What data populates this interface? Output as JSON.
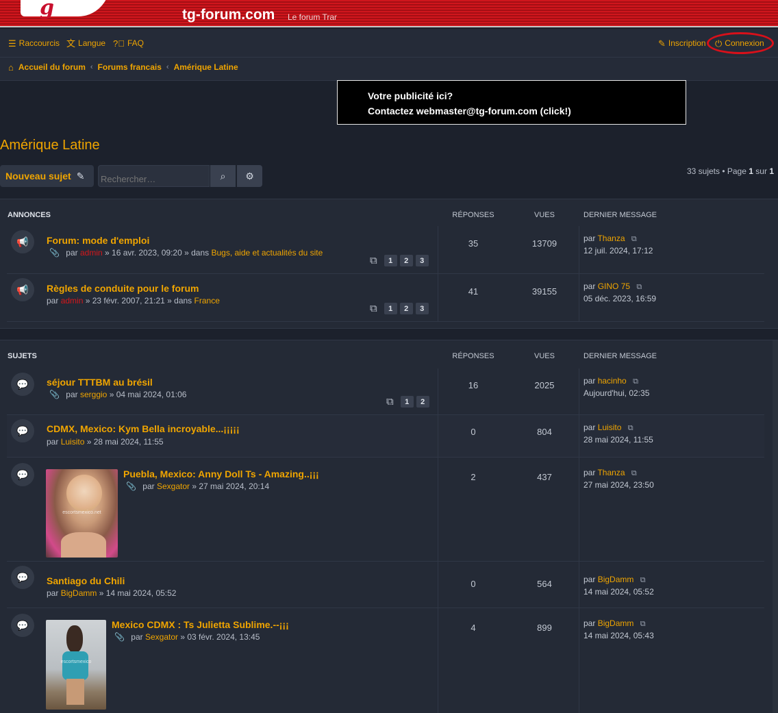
{
  "site": {
    "title": "tg-forum.com",
    "description": "Le forum Tran"
  },
  "nav": {
    "quick_links": "Raccourcis",
    "language": "Langue",
    "faq": "FAQ",
    "register": "Inscription",
    "login": "Connexion"
  },
  "breadcrumbs": [
    "Accueil du forum",
    "Forums francais",
    "Amérique Latine"
  ],
  "ad": {
    "line1": "Votre publicité ici?",
    "line2": "Contactez webmaster@tg-forum.com (click!)"
  },
  "forum": {
    "title": "Amérique Latine",
    "new_topic": "Nouveau sujet",
    "search_placeholder": "Rechercher…",
    "topic_count": "33 sujets • Page",
    "page_current": "1",
    "page_of": "sur",
    "page_total": "1"
  },
  "columns": {
    "replies": "RÉPONSES",
    "views": "VUES",
    "last_post": "DERNIER MESSAGE"
  },
  "announcements": {
    "label": "ANNONCES",
    "rows": [
      {
        "title": "Forum: mode d'emploi",
        "by": "par",
        "author": "admin",
        "date": "» 16 avr. 2023, 09:20 » dans",
        "forum": "Bugs, aide et actualités du site",
        "pages": [
          "1",
          "2",
          "3"
        ],
        "replies": "35",
        "views": "13709",
        "last_by": "par",
        "last_user": "Thanza",
        "last_date": "12 juil. 2024, 17:12"
      },
      {
        "title": "Règles de conduite pour le forum",
        "by": "par",
        "author": "admin",
        "date": "» 23 févr. 2007, 21:21 » dans",
        "forum": "France",
        "pages": [
          "1",
          "2",
          "3"
        ],
        "replies": "41",
        "views": "39155",
        "last_by": "par",
        "last_user": "GINO 75",
        "last_date": "05 déc. 2023, 16:59"
      }
    ]
  },
  "topics": {
    "label": "SUJETS",
    "rows": [
      {
        "title": "séjour TTTBM au brésil",
        "by": "par",
        "author": "serggio",
        "date": "» 04 mai 2024, 01:06",
        "pages": [
          "1",
          "2"
        ],
        "replies": "16",
        "views": "2025",
        "last_by": "par",
        "last_user": "hacinho",
        "last_date": "Aujourd'hui, 02:35"
      },
      {
        "title": "CDMX, Mexico: Kym Bella incroyable...¡¡¡¡¡",
        "by": "par",
        "author": "Luisito",
        "date": "» 28 mai 2024, 11:55",
        "replies": "0",
        "views": "804",
        "last_by": "par",
        "last_user": "Luisito",
        "last_date": "28 mai 2024, 11:55"
      },
      {
        "title": "Puebla, Mexico: Anny Doll Ts - Amazing..¡¡¡",
        "by": "par",
        "author": "Sexgator",
        "date": "» 27 mai 2024, 20:14",
        "thumb_text": "escortsmexico.net",
        "replies": "2",
        "views": "437",
        "last_by": "par",
        "last_user": "Thanza",
        "last_date": "27 mai 2024, 23:50"
      },
      {
        "title": "Santiago du Chili",
        "by": "par",
        "author": "BigDamm",
        "date": "» 14 mai 2024, 05:52",
        "replies": "0",
        "views": "564",
        "last_by": "par",
        "last_user": "BigDamm",
        "last_date": "14 mai 2024, 05:52"
      },
      {
        "title": "Mexico CDMX : Ts Julietta Sublime.--¡¡¡",
        "by": "par",
        "author": "Sexgator",
        "date": "» 03 févr. 2024, 13:45",
        "thumb_text": "escortsmexico",
        "replies": "4",
        "views": "899",
        "last_by": "par",
        "last_user": "BigDamm",
        "last_date": "14 mai 2024, 05:43"
      }
    ]
  },
  "icons": {
    "announcement": "megaphone-icon",
    "topic": "speech-bubble-icon",
    "goto_last": "external-link-icon",
    "attachment": "paperclip-icon",
    "pages": "copy-icon"
  }
}
